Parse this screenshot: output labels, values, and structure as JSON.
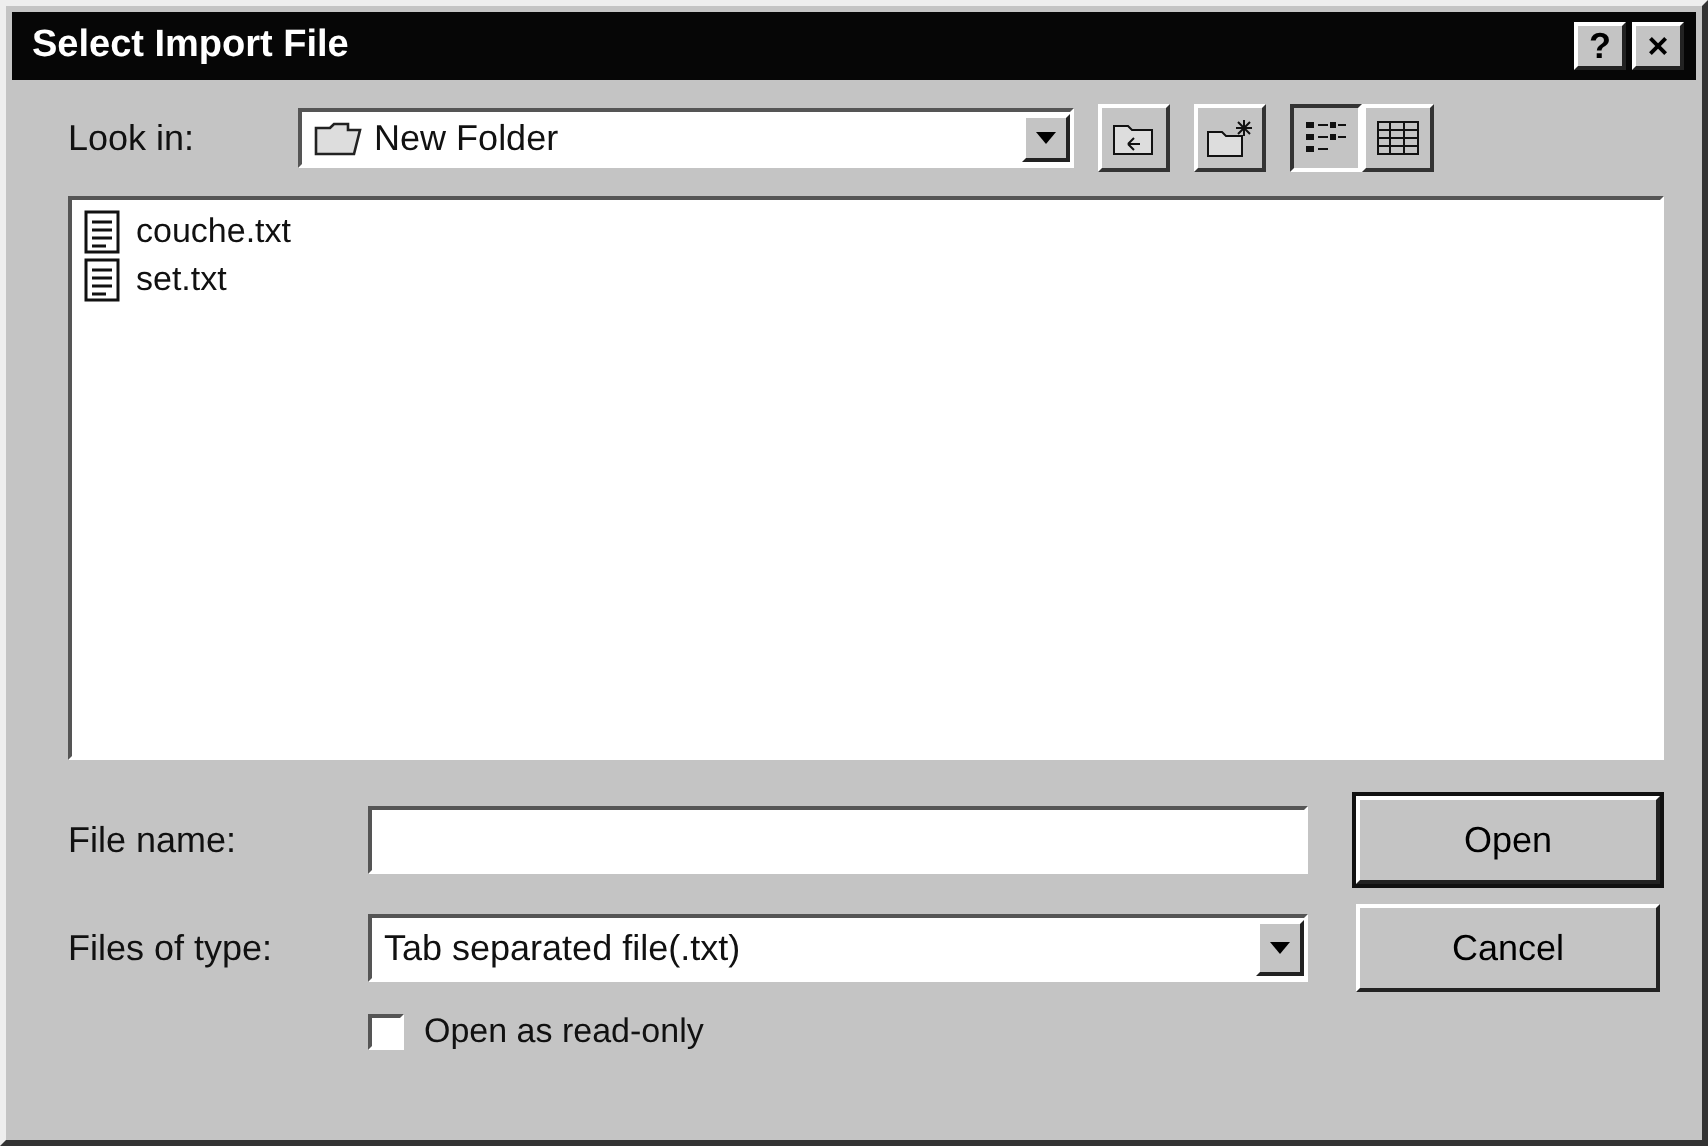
{
  "window": {
    "title": "Select Import File",
    "help_label": "?",
    "close_label": "×"
  },
  "look_in": {
    "label": "Look in:",
    "value": "New Folder"
  },
  "files": [
    {
      "name": "couche.txt"
    },
    {
      "name": "set.txt"
    }
  ],
  "file_name": {
    "label": "File name:"
  },
  "file_type": {
    "label": "Files of type:",
    "value": "Tab separated file(.txt)"
  },
  "read_only": {
    "label": "Open as read-only",
    "checked": false
  },
  "buttons": [
    {
      "label": "Open",
      "default": true
    },
    {
      "label": "Cancel",
      "default": false
    }
  ]
}
